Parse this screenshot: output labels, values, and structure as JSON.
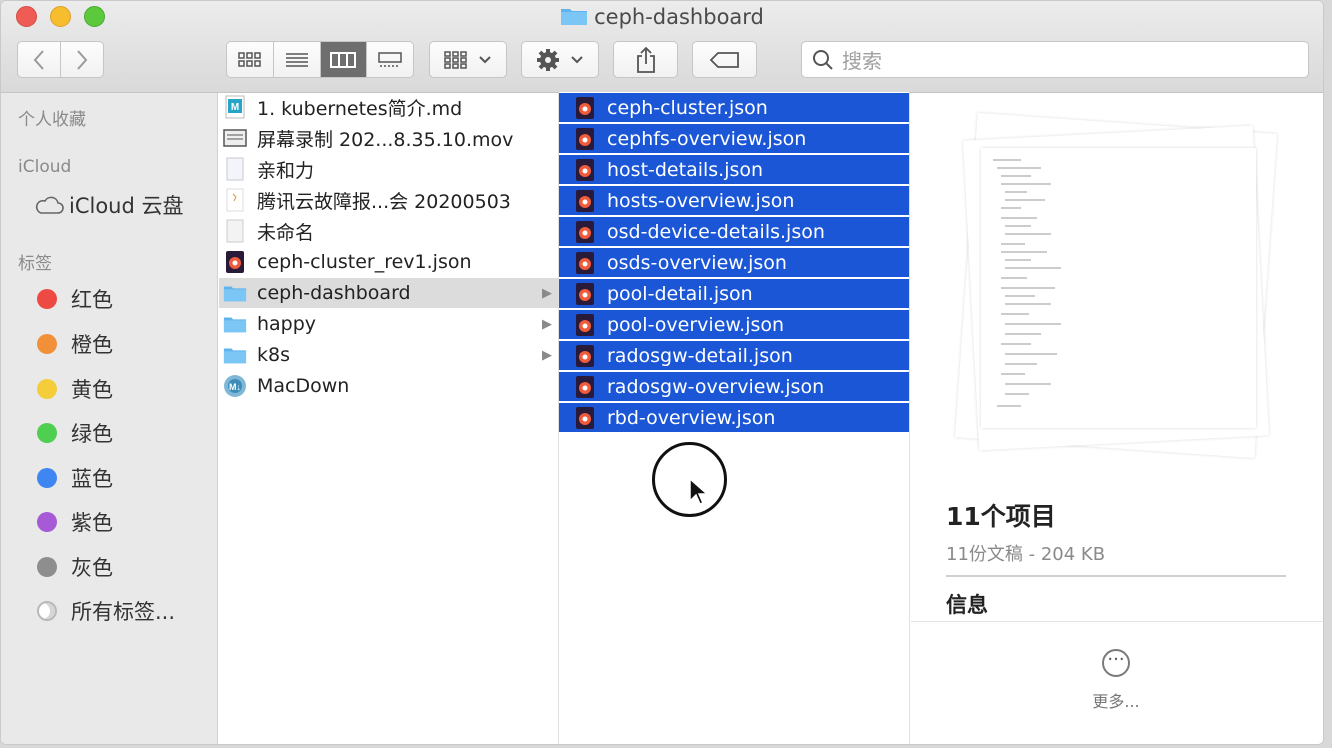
{
  "window": {
    "title": "ceph-dashboard"
  },
  "toolbar": {
    "back_icon": "chevron-left-icon",
    "forward_icon": "chevron-right-icon",
    "view_modes": [
      "icon-view",
      "list-view",
      "column-view",
      "gallery-view"
    ],
    "active_view": "column-view",
    "search_placeholder": "搜索"
  },
  "sidebar": {
    "favorites_header": "个人收藏",
    "icloud_header": "iCloud",
    "icloud_item": "iCloud 云盘",
    "tags_header": "标签",
    "tags": [
      {
        "label": "红色",
        "color": "#ee4a44"
      },
      {
        "label": "橙色",
        "color": "#f0913a"
      },
      {
        "label": "黄色",
        "color": "#f5cd3a"
      },
      {
        "label": "绿色",
        "color": "#4fcf4f"
      },
      {
        "label": "蓝色",
        "color": "#3f86f2"
      },
      {
        "label": "紫色",
        "color": "#a75ad6"
      },
      {
        "label": "灰色",
        "color": "#8e8e8e"
      }
    ],
    "all_tags": "所有标签..."
  },
  "column1": {
    "items": [
      {
        "name": "1. kubernetes简介.md",
        "icon": "markdown-file-icon"
      },
      {
        "name": "屏幕录制 202...8.35.10.mov",
        "icon": "movie-file-icon"
      },
      {
        "name": "亲和力",
        "icon": "document-icon"
      },
      {
        "name": "腾讯云故障报...会 20200503",
        "icon": "document-icon"
      },
      {
        "name": "未命名",
        "icon": "document-icon"
      },
      {
        "name": "ceph-cluster_rev1.json",
        "icon": "json-file-icon"
      },
      {
        "name": "ceph-dashboard",
        "icon": "folder-icon"
      },
      {
        "name": "happy",
        "icon": "folder-icon"
      },
      {
        "name": "k8s",
        "icon": "folder-icon"
      },
      {
        "name": "MacDown",
        "icon": "app-icon"
      }
    ]
  },
  "column2": {
    "items": [
      "ceph-cluster.json",
      "cephfs-overview.json",
      "host-details.json",
      "hosts-overview.json",
      "osd-device-details.json",
      "osds-overview.json",
      "pool-detail.json",
      "pool-overview.json",
      "radosgw-detail.json",
      "radosgw-overview.json",
      "rbd-overview.json"
    ]
  },
  "preview": {
    "title": "11个项目",
    "subtitle": "11份文稿 - 204 KB",
    "info_header": "信息",
    "more_label": "更多..."
  }
}
